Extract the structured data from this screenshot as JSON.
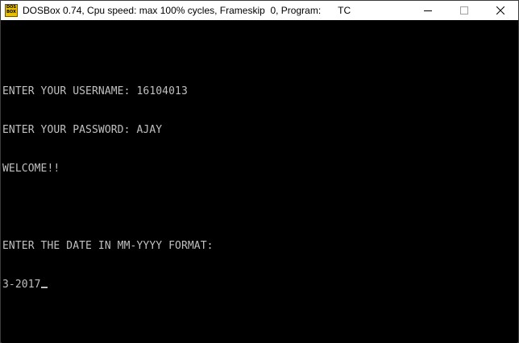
{
  "window": {
    "title": "DOSBox 0.74, Cpu speed: max 100% cycles, Frameskip  0, Program:",
    "program": "TC",
    "icon": "dosbox-icon",
    "icon_text_top": "DOS",
    "icon_text_bottom": "BOX",
    "controls": [
      "minimize-icon",
      "maximize-icon",
      "close-icon"
    ]
  },
  "console": {
    "lines": [
      "ENTER YOUR USERNAME: 16104013",
      "ENTER YOUR PASSWORD: AJAY",
      "WELCOME!!",
      "",
      "ENTER THE DATE IN MM-YYYY FORMAT:",
      "3-2017"
    ],
    "text_color": "#c0c0c0",
    "background_color": "#000000"
  }
}
